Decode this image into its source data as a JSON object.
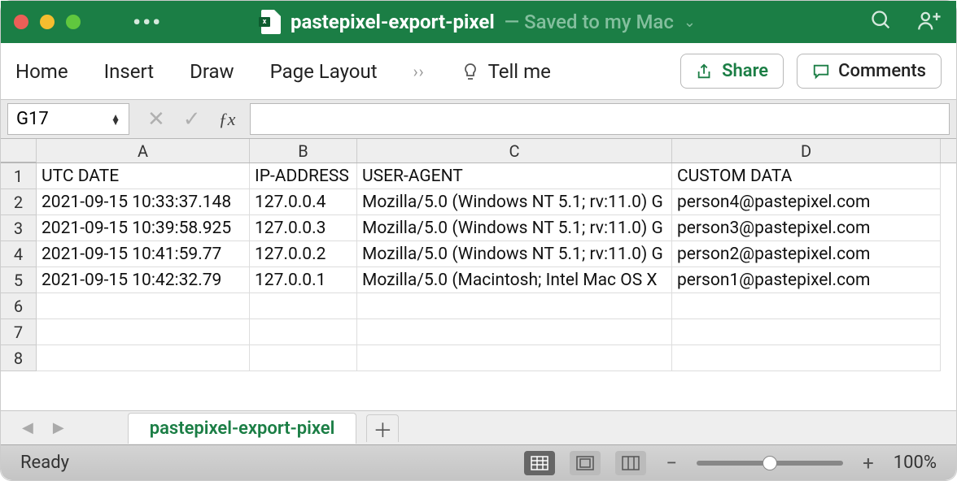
{
  "titlebar": {
    "filename": "pastepixel-export-pixel",
    "saved_status": "— Saved to my Mac"
  },
  "ribbon": {
    "home": "Home",
    "insert": "Insert",
    "draw": "Draw",
    "page_layout": "Page Layout",
    "tell_me": "Tell me",
    "share": "Share",
    "comments": "Comments"
  },
  "formula_bar": {
    "name_box": "G17"
  },
  "grid": {
    "columns": [
      "A",
      "B",
      "C",
      "D"
    ],
    "rows": [
      {
        "n": "1",
        "A": "UTC DATE",
        "B": "IP-ADDRESS",
        "C": "USER-AGENT",
        "D": "CUSTOM DATA"
      },
      {
        "n": "2",
        "A": "2021-09-15 10:33:37.148",
        "B": "127.0.0.4",
        "C": "Mozilla/5.0 (Windows NT 5.1; rv:11.0) G",
        "D": "person4@pastepixel.com"
      },
      {
        "n": "3",
        "A": "2021-09-15 10:39:58.925",
        "B": "127.0.0.3",
        "C": "Mozilla/5.0 (Windows NT 5.1; rv:11.0) G",
        "D": "person3@pastepixel.com"
      },
      {
        "n": "4",
        "A": "2021-09-15 10:41:59.77",
        "B": "127.0.0.2",
        "C": "Mozilla/5.0 (Windows NT 5.1; rv:11.0) G",
        "D": "person2@pastepixel.com"
      },
      {
        "n": "5",
        "A": "2021-09-15 10:42:32.79",
        "B": "127.0.0.1",
        "C": "Mozilla/5.0 (Macintosh; Intel Mac OS X ",
        "D": "person1@pastepixel.com"
      },
      {
        "n": "6",
        "A": "",
        "B": "",
        "C": "",
        "D": ""
      },
      {
        "n": "7",
        "A": "",
        "B": "",
        "C": "",
        "D": ""
      },
      {
        "n": "8",
        "A": "",
        "B": "",
        "C": "",
        "D": ""
      }
    ]
  },
  "sheet_tabs": {
    "active": "pastepixel-export-pixel"
  },
  "statusbar": {
    "ready": "Ready",
    "zoom": "100%"
  }
}
